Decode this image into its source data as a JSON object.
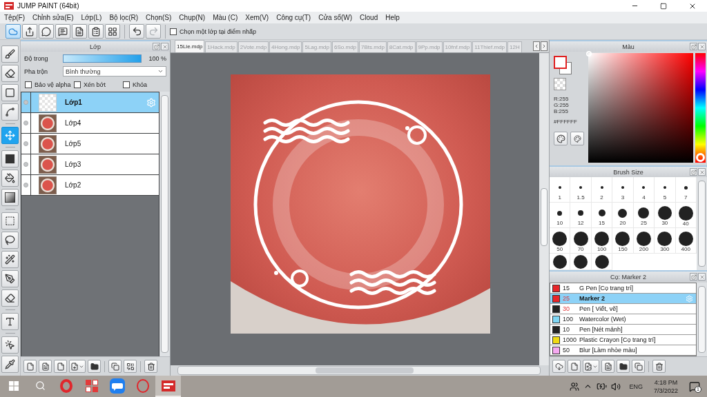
{
  "window": {
    "title": "JUMP PAINT (64bit)"
  },
  "menu": [
    "Tệp(F)",
    "Chỉnh sửa(E)",
    "Lớp(L)",
    "Bộ lọc(R)",
    "Chọn(S)",
    "Chụp(N)",
    "Màu (C)",
    "Xem(V)",
    "Công cụ(T)",
    "Cửa sổ(W)",
    "Cloud",
    "Help"
  ],
  "toolbar": {
    "buttons": [
      {
        "selected": true
      },
      {
        "selected": false
      },
      {
        "selected": false
      },
      {
        "selected": false
      },
      {
        "selected": false
      },
      {
        "selected": false
      },
      {
        "selected": false
      }
    ],
    "history": [
      {
        "disabled": false
      },
      {
        "disabled": true
      }
    ],
    "option": {
      "label": "Chọn một lớp tại điểm nhấp",
      "checked": false
    }
  },
  "tools": [
    {
      "selected": false
    },
    {
      "selected": false
    },
    {
      "selected": false
    },
    {
      "selected": false
    },
    {
      "selected": true
    },
    {
      "selected": false
    },
    {
      "selected": false
    },
    {
      "selected": false
    },
    {
      "selected": false
    },
    {
      "selected": false
    },
    {
      "selected": false
    },
    {
      "selected": false
    },
    {
      "selected": false
    },
    {
      "selected": false
    },
    {
      "selected": false
    },
    {
      "selected": false
    }
  ],
  "layer_panel": {
    "title": "Lớp",
    "opacity": {
      "label": "Độ trong",
      "level": 1,
      "reading": "100 %"
    },
    "blend": {
      "label": "Pha trộn",
      "value": "Bình thường"
    },
    "options": [
      {
        "label": "Bảo vệ alpha",
        "checked": false
      },
      {
        "label": "Xén bớt",
        "checked": false
      },
      {
        "label": "Khóa",
        "checked": false
      }
    ],
    "layers": [
      {
        "name": "Lớp1",
        "kind": "transparent",
        "selected": true
      },
      {
        "name": "Lớp4",
        "kind": "image",
        "selected": false
      },
      {
        "name": "Lớp5",
        "kind": "image",
        "selected": false
      },
      {
        "name": "Lớp3",
        "kind": "image",
        "selected": false
      },
      {
        "name": "Lớp2",
        "kind": "image",
        "selected": false
      }
    ]
  },
  "documents": [
    {
      "name": "15Lie.mdp",
      "selected": true
    },
    {
      "name": "1Hack.mdp",
      "selected": false
    },
    {
      "name": "2Vote.mdp",
      "selected": false
    },
    {
      "name": "4Hong.mdp",
      "selected": false
    },
    {
      "name": "5Lag.mdp",
      "selected": false
    },
    {
      "name": "6So.mdp",
      "selected": false
    },
    {
      "name": "7Bts.mdp",
      "selected": false
    },
    {
      "name": "8Cat.mdp",
      "selected": false
    },
    {
      "name": "9Pp.mdp",
      "selected": false
    },
    {
      "name": "10fnf.mdp",
      "selected": false
    },
    {
      "name": "11Thief.mdp",
      "selected": false
    },
    {
      "name": "12H",
      "selected": false
    }
  ],
  "color_panel": {
    "title": "Màu",
    "channels": [
      "R:255",
      "G:255",
      "B:255"
    ],
    "hex": "#FFFFFF",
    "hue": {
      "level": 0
    }
  },
  "brush_size_panel": {
    "title": "Brush Size",
    "sizes": [
      "1",
      "1.5",
      "2",
      "3",
      "4",
      "5",
      "7",
      "10",
      "12",
      "15",
      "20",
      "25",
      "30",
      "40",
      "50",
      "70",
      "100",
      "150",
      "200",
      "300",
      "400"
    ]
  },
  "brush_panel": {
    "title": "Cọ: Marker 2",
    "brushes": [
      {
        "color": "#e8262a",
        "size": "15",
        "name": "G Pen [Cọ trang trí]",
        "size_highlighted": false,
        "selected": false
      },
      {
        "color": "#e8262a",
        "size": "25",
        "name": "Marker 2",
        "size_highlighted": true,
        "selected": true
      },
      {
        "color": "#222222",
        "size": "30",
        "name": "Pen [ Viết, vẽ]",
        "size_highlighted": true,
        "selected": false
      },
      {
        "color": "#7fd6f4",
        "size": "100",
        "name": "Watercolor (Wet)",
        "size_highlighted": false,
        "selected": false
      },
      {
        "color": "#222222",
        "size": "10",
        "name": "Pen [Nét mảnh]",
        "size_highlighted": false,
        "selected": false
      },
      {
        "color": "#f0da12",
        "size": "1000",
        "name": "Plastic Crayon [Cọ trang trí]",
        "size_highlighted": false,
        "selected": false
      },
      {
        "color": "#f6a9f1",
        "size": "50",
        "name": "Blur [Làm nhòe màu]",
        "size_highlighted": false,
        "selected": false
      }
    ]
  },
  "taskbar": {
    "apps": [
      {
        "selected": false
      },
      {
        "selected": false
      },
      {
        "selected": false
      },
      {
        "selected": false
      },
      {
        "selected": true
      }
    ],
    "tray": {
      "language": "ENG",
      "time": "4:18 PM",
      "date": "7/3/2022",
      "badge": "1"
    }
  }
}
